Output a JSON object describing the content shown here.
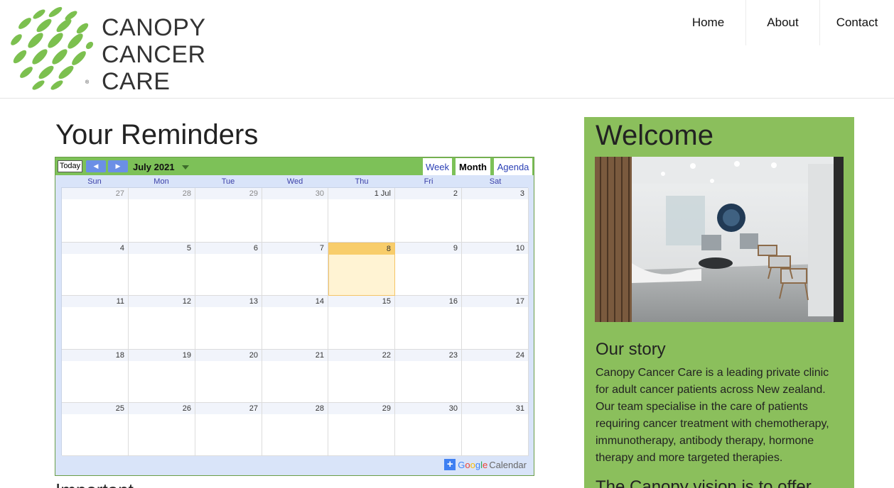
{
  "brand": {
    "name_lines": [
      "CANOPY",
      "CANCER",
      "CARE"
    ],
    "registered_mark": "®",
    "accent_color": "#7cc04f"
  },
  "nav": {
    "items": [
      {
        "label": "Home"
      },
      {
        "label": "About"
      },
      {
        "label": "Contact"
      }
    ]
  },
  "main": {
    "title": "Your Reminders",
    "next_heading": "Important"
  },
  "calendar": {
    "today_button": "Today",
    "prev_icon": "◀",
    "next_icon": "▶",
    "month_label": "July 2021",
    "tabs": [
      {
        "label": "Week",
        "active": false
      },
      {
        "label": "Month",
        "active": true
      },
      {
        "label": "Agenda",
        "active": false
      }
    ],
    "weekdays": [
      "Sun",
      "Mon",
      "Tue",
      "Wed",
      "Thu",
      "Fri",
      "Sat"
    ],
    "weeks": [
      [
        {
          "d": "27",
          "other": true
        },
        {
          "d": "28",
          "other": true
        },
        {
          "d": "29",
          "other": true
        },
        {
          "d": "30",
          "other": true
        },
        {
          "d": "1 Jul"
        },
        {
          "d": "2"
        },
        {
          "d": "3"
        }
      ],
      [
        {
          "d": "4"
        },
        {
          "d": "5"
        },
        {
          "d": "6"
        },
        {
          "d": "7"
        },
        {
          "d": "8",
          "today": true
        },
        {
          "d": "9"
        },
        {
          "d": "10"
        }
      ],
      [
        {
          "d": "11"
        },
        {
          "d": "12"
        },
        {
          "d": "13"
        },
        {
          "d": "14"
        },
        {
          "d": "15"
        },
        {
          "d": "16"
        },
        {
          "d": "17"
        }
      ],
      [
        {
          "d": "18"
        },
        {
          "d": "19"
        },
        {
          "d": "20"
        },
        {
          "d": "21"
        },
        {
          "d": "22"
        },
        {
          "d": "23"
        },
        {
          "d": "24"
        }
      ],
      [
        {
          "d": "25"
        },
        {
          "d": "26"
        },
        {
          "d": "27"
        },
        {
          "d": "28"
        },
        {
          "d": "29"
        },
        {
          "d": "30"
        },
        {
          "d": "31"
        }
      ]
    ],
    "footer_plus": "+",
    "footer_google": "Google",
    "footer_calendar": "Calendar"
  },
  "sidebar": {
    "welcome": "Welcome",
    "story_title": "Our story",
    "story_text": "Canopy Cancer Care is a leading private clinic for adult cancer patients across New zealand. Our team specialise in the care of patients requiring cancer treatment with chemotherapy, immunotherapy, antibody therapy, hormone therapy and more targeted therapies.",
    "vision_heading": "The Canopy vision is to offer"
  }
}
